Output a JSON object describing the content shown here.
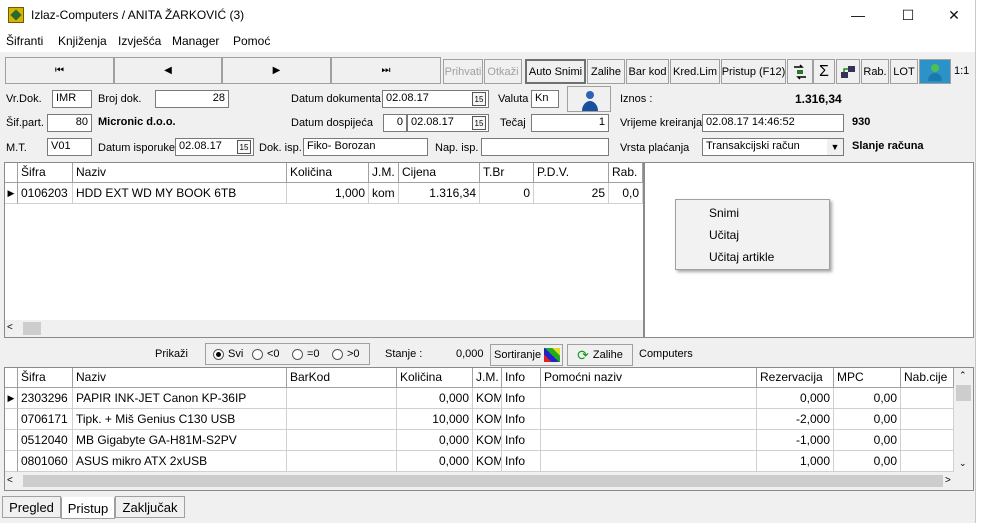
{
  "window": {
    "title": "Izlaz-Computers / ANITA ŽARKOVIĆ (3)",
    "minimize": "—",
    "maximize": "☐",
    "close": "✕"
  },
  "menu": [
    "Šifranti",
    "Knjiženja",
    "Izvješća",
    "Manager",
    "Pomoć"
  ],
  "nav": {
    "first": "⏮",
    "prev": "◀",
    "next": "▶",
    "last": "⏭"
  },
  "toolbar": {
    "prihvati": "Prihvati",
    "otkazi": "Otkaži",
    "auto_snimi": "Auto Snimi",
    "zalihe": "Zalihe",
    "bar_kod": "Bar kod",
    "kred_lim": "Kred.Lim",
    "pristup": "Pristup (F12)",
    "sigma": "Σ",
    "rab": "Rab.",
    "lot": "LOT",
    "ratio": "1:1"
  },
  "header": {
    "vr_dok_label": "Vr.Dok.",
    "vr_dok": "IMR",
    "broj_dok_label": "Broj dok.",
    "broj_dok": "28",
    "datum_dokumenta_label": "Datum dokumenta",
    "datum_dokumenta": "02.08.17",
    "valuta_label": "Valuta",
    "valuta": "Kn",
    "iznos_label": "Iznos :",
    "iznos": "1.316,34",
    "sif_part_label": "Šif.part.",
    "sif_part": "80",
    "partner_name": "Micronic d.o.o.",
    "datum_dospijeca_label": "Datum dospijeća",
    "dospijece_dani": "0",
    "datum_dospijeca": "02.08.17",
    "tecaj_label": "Tečaj",
    "tecaj": "1",
    "vrijeme_kreiranja_label": "Vrijeme kreiranja",
    "vrijeme_kreiranja": "02.08.17 14:46:52",
    "code_930": "930",
    "mt_label": "M.T.",
    "mt": "V01",
    "datum_isporuke_label": "Datum isporuke",
    "datum_isporuke": "02.08.17",
    "dok_isp_label": "Dok. isp.",
    "dok_isp": "Fiko- Borozan",
    "nap_isp_label": "Nap. isp.",
    "nap_isp": "",
    "vrsta_placanja_label": "Vrsta plaćanja",
    "vrsta_placanja": "Transakcijski račun",
    "slanje_racuna": "Slanje računa"
  },
  "items_grid": {
    "columns": [
      "Šifra",
      "Naziv",
      "Količina",
      "J.M.",
      "Cijena",
      "T.Br",
      "P.D.V.",
      "Rab."
    ],
    "rows": [
      [
        "0106203",
        "HDD EXT WD MY BOOK 6TB",
        "1,000",
        "kom",
        "1.316,34",
        "0",
        "25",
        "0,0"
      ]
    ]
  },
  "context_menu": [
    "Snimi",
    "Učitaj",
    "Učitaj artikle"
  ],
  "filter_bar": {
    "prikazi": "Prikaži",
    "options": [
      "Svi",
      "<0",
      "=0",
      ">0"
    ],
    "stanje_label": "Stanje :",
    "stanje": "0,000",
    "sortiranje": "Sortiranje",
    "zalihe": "Zalihe",
    "computers": "Computers"
  },
  "stock_grid": {
    "columns": [
      "Šifra",
      "Naziv",
      "BarKod",
      "Količina",
      "J.M.",
      "Info",
      "Pomoćni naziv",
      "Rezervacija",
      "MPC",
      "Nab.cije"
    ],
    "rows": [
      [
        "2303296",
        "PAPIR INK-JET Canon KP-36IP",
        "",
        "0,000",
        "KOM",
        "Info",
        "",
        "0,000",
        "0,00",
        ""
      ],
      [
        "0706171",
        "Tipk. + Miš Genius C130 USB",
        "",
        "10,000",
        "KOM",
        "Info",
        "",
        "-2,000",
        "0,00",
        ""
      ],
      [
        "0512040",
        "MB Gigabyte GA-H81M-S2PV",
        "",
        "0,000",
        "KOM",
        "Info",
        "",
        "-1,000",
        "0,00",
        ""
      ],
      [
        "0801060",
        " ASUS mikro ATX 2xUSB",
        "",
        "0,000",
        "KOM",
        "Info",
        "",
        "1,000",
        "0,00",
        ""
      ]
    ]
  },
  "tabs": [
    "Pregled",
    "Pristup",
    "Zaključak"
  ]
}
